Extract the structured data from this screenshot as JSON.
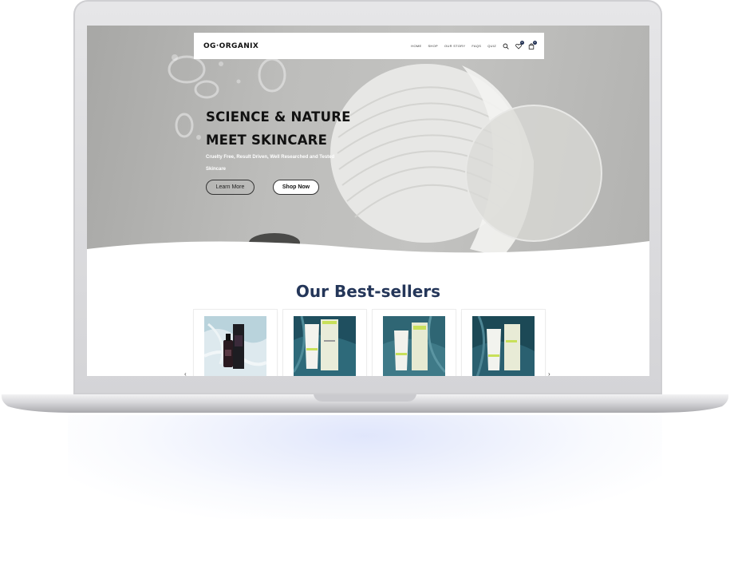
{
  "brand": {
    "logo_text": "OG·ORGANIX"
  },
  "nav": {
    "links": [
      "HOME",
      "SHOP",
      "OUR STORY",
      "FAQS",
      "QUIZ"
    ],
    "icons": [
      "search-icon",
      "heart-icon",
      "bag-icon"
    ],
    "wishlist_count": "0",
    "cart_count": "0"
  },
  "hero": {
    "title_line1": "SCIENCE & NATURE",
    "title_line2": "MEET SKINCARE",
    "subtitle_line1": "Cruelty Free, Result Driven, Well Researched and Tested",
    "subtitle_line2": "Skincare",
    "learn_more_label": "Learn More",
    "shop_now_label": "Shop Now"
  },
  "best_sellers": {
    "title": "Our Best-sellers",
    "products": [
      {
        "kind": "serum-bottle"
      },
      {
        "kind": "tube-and-box"
      },
      {
        "kind": "tube-and-box"
      },
      {
        "kind": "tube-and-box"
      }
    ]
  },
  "colors": {
    "accent": "#243659",
    "hero_bg": "#bdbdbb",
    "lime": "#c8e05a"
  }
}
